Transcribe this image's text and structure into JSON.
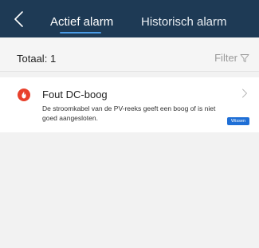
{
  "header": {
    "back_icon": "chevron-left-icon",
    "tabs": [
      {
        "label": "Actief alarm",
        "active": true
      },
      {
        "label": "Historisch alarm",
        "active": false
      }
    ],
    "background": "#1e3a55",
    "accent": "#4a9be6"
  },
  "summary": {
    "total_label": "Totaal:",
    "total_count": "1",
    "filter_label": "Filter",
    "filter_icon": "funnel-icon"
  },
  "alarms": [
    {
      "icon": "critical-alarm-icon",
      "icon_color": "#e8412c",
      "title": "Fout DC-boog",
      "description": "De stroomkabel van de PV-reeks geeft een boog of is niet goed aangesloten.",
      "badge": "Wissen",
      "badge_color": "#1f6fd6"
    }
  ]
}
